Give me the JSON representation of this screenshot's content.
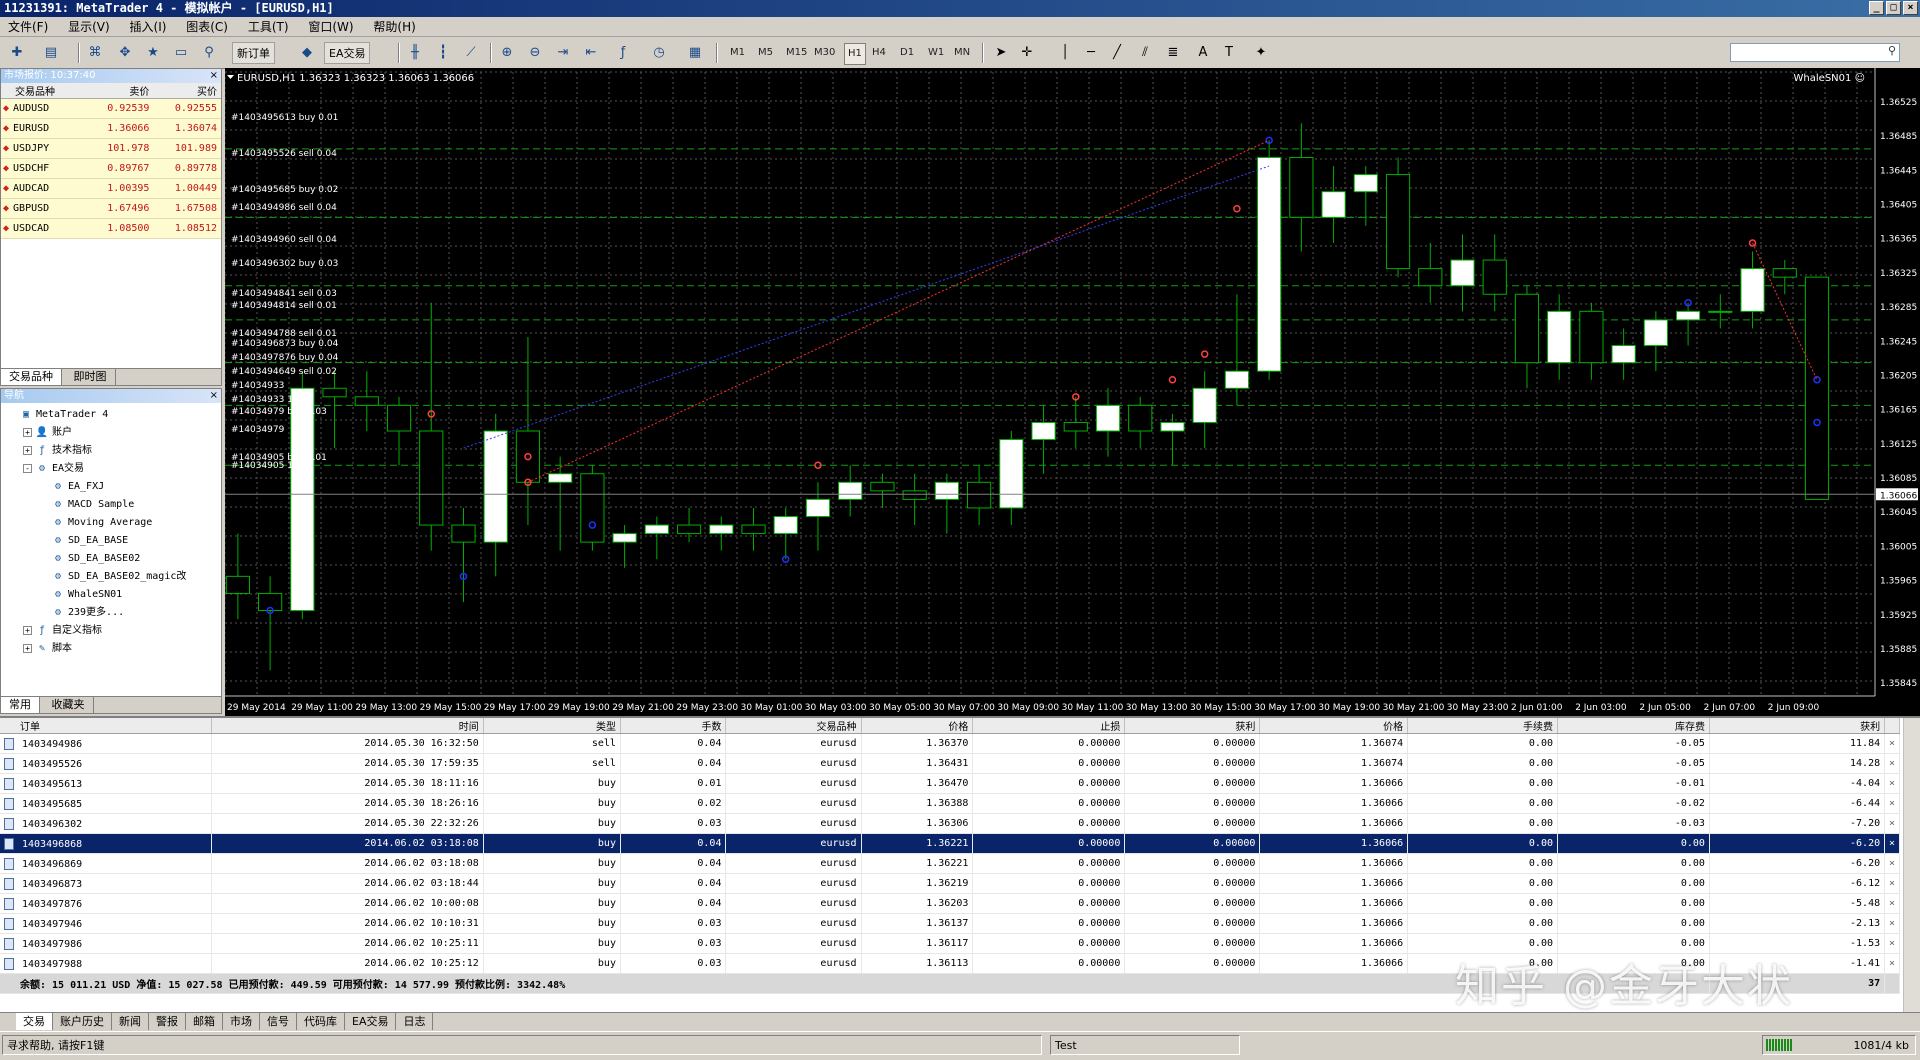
{
  "window": {
    "title": "11231391: MetaTrader 4 - 模拟帐户 - [EURUSD,H1]",
    "ctl_min": "_",
    "ctl_max": "□",
    "ctl_close": "×"
  },
  "menu": [
    "文件(F)",
    "显示(V)",
    "插入(I)",
    "图表(C)",
    "工具(T)",
    "窗口(W)",
    "帮助(H)"
  ],
  "toolbar": {
    "new_order": "新订单",
    "ea_trading": "EA交易",
    "timeframes": [
      "M1",
      "M5",
      "M15",
      "M30",
      "H1",
      "H4",
      "D1",
      "W1",
      "MN"
    ],
    "active_timeframe": "H1"
  },
  "market_watch": {
    "title": "市场报价: 10:37:40",
    "headers": [
      "交易品种",
      "卖价",
      "买价"
    ],
    "rows": [
      {
        "symbol": "AUDUSD",
        "bid": "0.92539",
        "ask": "0.92555"
      },
      {
        "symbol": "EURUSD",
        "bid": "1.36066",
        "ask": "1.36074"
      },
      {
        "symbol": "USDJPY",
        "bid": "101.978",
        "ask": "101.989"
      },
      {
        "symbol": "USDCHF",
        "bid": "0.89767",
        "ask": "0.89778"
      },
      {
        "symbol": "AUDCAD",
        "bid": "1.00395",
        "ask": "1.00449"
      },
      {
        "symbol": "GBPUSD",
        "bid": "1.67496",
        "ask": "1.67508"
      },
      {
        "symbol": "USDCAD",
        "bid": "1.08500",
        "ask": "1.08512"
      }
    ],
    "tabs": [
      "交易品种",
      "即时图"
    ]
  },
  "navigator": {
    "title": "导航",
    "items": [
      {
        "label": "MetaTrader 4",
        "level": 0,
        "expand": ""
      },
      {
        "label": "账户",
        "level": 1,
        "expand": "+"
      },
      {
        "label": "技术指标",
        "level": 1,
        "expand": "+"
      },
      {
        "label": "EA交易",
        "level": 1,
        "expand": "-"
      },
      {
        "label": "EA_FXJ",
        "level": 2,
        "expand": ""
      },
      {
        "label": "MACD Sample",
        "level": 2,
        "expand": ""
      },
      {
        "label": "Moving Average",
        "level": 2,
        "expand": ""
      },
      {
        "label": "SD_EA_BASE",
        "level": 2,
        "expand": ""
      },
      {
        "label": "SD_EA_BASE02",
        "level": 2,
        "expand": ""
      },
      {
        "label": "SD_EA_BASE02_magic改",
        "level": 2,
        "expand": ""
      },
      {
        "label": "WhaleSN01",
        "level": 2,
        "expand": ""
      },
      {
        "label": "239更多...",
        "level": 2,
        "expand": ""
      },
      {
        "label": "自定义指标",
        "level": 1,
        "expand": "+"
      },
      {
        "label": "脚本",
        "level": 1,
        "expand": "+"
      }
    ],
    "tabs": [
      "常用",
      "收藏夹"
    ]
  },
  "chart": {
    "header": "EURUSD,H1  1.36323 1.36323 1.36063 1.36066",
    "ea_label": "WhaleSN01 ☺",
    "current_price": "1.36066",
    "order_labels": [
      "#1403495613 buy 0.01",
      "#1403495526 sell 0.04",
      "#1403495685 buy 0.02",
      "#1403494986 sell 0.04",
      "#1403494960 sell 0.04",
      "#1403496302 buy 0.03",
      "#1403494841 sell 0.03",
      "#1403494814 sell 0.01",
      "#1403494788 sell 0.01",
      "#1403496873 buy 0.04",
      "#1403497876 buy 0.04",
      "#1403494649 sell 0.02",
      "#14034933",
      "#14034933 1.02",
      "#14034979 buy 0.03",
      "#14034979",
      "#14034905 buy 0.01",
      "#14034905 1.01"
    ],
    "time_labels": [
      "29 May 2014",
      "29 May 11:00",
      "29 May 13:00",
      "29 May 15:00",
      "29 May 17:00",
      "29 May 19:00",
      "29 May 21:00",
      "29 May 23:00",
      "30 May 01:00",
      "30 May 03:00",
      "30 May 05:00",
      "30 May 07:00",
      "30 May 09:00",
      "30 May 11:00",
      "30 May 13:00",
      "30 May 15:00",
      "30 May 17:00",
      "30 May 19:00",
      "30 May 21:00",
      "30 May 23:00",
      "2 Jun 01:00",
      "2 Jun 03:00",
      "2 Jun 05:00",
      "2 Jun 07:00",
      "2 Jun 09:00"
    ],
    "price_labels": [
      "1.36525",
      "1.36485",
      "1.36445",
      "1.36405",
      "1.36365",
      "1.36325",
      "1.36285",
      "1.36245",
      "1.36205",
      "1.36165",
      "1.36125",
      "1.36085",
      "1.36045",
      "1.36005",
      "1.35965",
      "1.35925",
      "1.35885",
      "1.35845"
    ]
  },
  "chart_data": {
    "type": "candlestick",
    "symbol": "EURUSD",
    "timeframe": "H1",
    "ylim": [
      1.3583,
      1.3656
    ],
    "candles": [
      [
        1.3597,
        1.3602,
        1.3592,
        1.3595
      ],
      [
        1.3595,
        1.3597,
        1.3586,
        1.3593
      ],
      [
        1.3593,
        1.3621,
        1.3592,
        1.3619
      ],
      [
        1.3619,
        1.3621,
        1.3612,
        1.3618
      ],
      [
        1.3618,
        1.3621,
        1.3614,
        1.3617
      ],
      [
        1.3617,
        1.3618,
        1.361,
        1.3614
      ],
      [
        1.3614,
        1.3629,
        1.36,
        1.3603
      ],
      [
        1.3603,
        1.3605,
        1.3594,
        1.3601
      ],
      [
        1.3601,
        1.3616,
        1.3597,
        1.3614
      ],
      [
        1.3614,
        1.3625,
        1.3603,
        1.3608
      ],
      [
        1.3608,
        1.3611,
        1.36,
        1.3609
      ],
      [
        1.3609,
        1.361,
        1.36,
        1.3601
      ],
      [
        1.3601,
        1.3603,
        1.3598,
        1.3602
      ],
      [
        1.3602,
        1.3604,
        1.3599,
        1.3603
      ],
      [
        1.3603,
        1.3605,
        1.3601,
        1.3602
      ],
      [
        1.3602,
        1.3604,
        1.36,
        1.3603
      ],
      [
        1.3603,
        1.3605,
        1.36,
        1.3602
      ],
      [
        1.3602,
        1.3605,
        1.3599,
        1.3604
      ],
      [
        1.3604,
        1.3608,
        1.36,
        1.3606
      ],
      [
        1.3606,
        1.361,
        1.3604,
        1.3608
      ],
      [
        1.3608,
        1.3609,
        1.3605,
        1.3607
      ],
      [
        1.3607,
        1.3609,
        1.3603,
        1.3606
      ],
      [
        1.3606,
        1.3609,
        1.3602,
        1.3608
      ],
      [
        1.3608,
        1.361,
        1.3603,
        1.3605
      ],
      [
        1.3605,
        1.3614,
        1.3603,
        1.3613
      ],
      [
        1.3613,
        1.3617,
        1.3609,
        1.3615
      ],
      [
        1.3615,
        1.3618,
        1.3612,
        1.3614
      ],
      [
        1.3614,
        1.3619,
        1.3611,
        1.3617
      ],
      [
        1.3617,
        1.3618,
        1.3612,
        1.3614
      ],
      [
        1.3614,
        1.3616,
        1.361,
        1.3615
      ],
      [
        1.3615,
        1.3621,
        1.3612,
        1.3619
      ],
      [
        1.3619,
        1.363,
        1.3617,
        1.3621
      ],
      [
        1.3621,
        1.3648,
        1.362,
        1.3646
      ],
      [
        1.3646,
        1.365,
        1.3635,
        1.3639
      ],
      [
        1.3639,
        1.3645,
        1.3636,
        1.3642
      ],
      [
        1.3642,
        1.3645,
        1.3638,
        1.3644
      ],
      [
        1.3644,
        1.3646,
        1.3632,
        1.3633
      ],
      [
        1.3633,
        1.3636,
        1.3629,
        1.3631
      ],
      [
        1.3631,
        1.3637,
        1.3628,
        1.3634
      ],
      [
        1.3634,
        1.3637,
        1.3628,
        1.363
      ],
      [
        1.363,
        1.3631,
        1.3619,
        1.3622
      ],
      [
        1.3622,
        1.363,
        1.362,
        1.3628
      ],
      [
        1.3628,
        1.3629,
        1.362,
        1.3622
      ],
      [
        1.3622,
        1.3626,
        1.362,
        1.3624
      ],
      [
        1.3624,
        1.3628,
        1.3621,
        1.3627
      ],
      [
        1.3627,
        1.3629,
        1.3624,
        1.3628
      ],
      [
        1.3628,
        1.363,
        1.3626,
        1.3628
      ],
      [
        1.3628,
        1.3635,
        1.3626,
        1.3633
      ],
      [
        1.3633,
        1.3634,
        1.363,
        1.3632
      ],
      [
        1.3632,
        1.3632,
        1.3606,
        1.3606
      ]
    ]
  },
  "terminal": {
    "headers": [
      "订单",
      "时间",
      "类型",
      "手数",
      "交易品种",
      "价格",
      "止损",
      "获利",
      "价格",
      "手续费",
      "库存费",
      "获利",
      ""
    ],
    "rows": [
      [
        "1403494986",
        "2014.05.30 16:32:50",
        "sell",
        "0.04",
        "eurusd",
        "1.36370",
        "0.00000",
        "0.00000",
        "1.36074",
        "0.00",
        "-0.05",
        "11.84",
        "×"
      ],
      [
        "1403495526",
        "2014.05.30 17:59:35",
        "sell",
        "0.04",
        "eurusd",
        "1.36431",
        "0.00000",
        "0.00000",
        "1.36074",
        "0.00",
        "-0.05",
        "14.28",
        "×"
      ],
      [
        "1403495613",
        "2014.05.30 18:11:16",
        "buy",
        "0.01",
        "eurusd",
        "1.36470",
        "0.00000",
        "0.00000",
        "1.36066",
        "0.00",
        "-0.01",
        "-4.04",
        "×"
      ],
      [
        "1403495685",
        "2014.05.30 18:26:16",
        "buy",
        "0.02",
        "eurusd",
        "1.36388",
        "0.00000",
        "0.00000",
        "1.36066",
        "0.00",
        "-0.02",
        "-6.44",
        "×"
      ],
      [
        "1403496302",
        "2014.05.30 22:32:26",
        "buy",
        "0.03",
        "eurusd",
        "1.36306",
        "0.00000",
        "0.00000",
        "1.36066",
        "0.00",
        "-0.03",
        "-7.20",
        "×"
      ],
      [
        "1403496868",
        "2014.06.02 03:18:08",
        "buy",
        "0.04",
        "eurusd",
        "1.36221",
        "0.00000",
        "0.00000",
        "1.36066",
        "0.00",
        "0.00",
        "-6.20",
        "×"
      ],
      [
        "1403496869",
        "2014.06.02 03:18:08",
        "buy",
        "0.04",
        "eurusd",
        "1.36221",
        "0.00000",
        "0.00000",
        "1.36066",
        "0.00",
        "0.00",
        "-6.20",
        "×"
      ],
      [
        "1403496873",
        "2014.06.02 03:18:44",
        "buy",
        "0.04",
        "eurusd",
        "1.36219",
        "0.00000",
        "0.00000",
        "1.36066",
        "0.00",
        "0.00",
        "-6.12",
        "×"
      ],
      [
        "1403497876",
        "2014.06.02 10:00:08",
        "buy",
        "0.04",
        "eurusd",
        "1.36203",
        "0.00000",
        "0.00000",
        "1.36066",
        "0.00",
        "0.00",
        "-5.48",
        "×"
      ],
      [
        "1403497946",
        "2014.06.02 10:10:31",
        "buy",
        "0.03",
        "eurusd",
        "1.36137",
        "0.00000",
        "0.00000",
        "1.36066",
        "0.00",
        "0.00",
        "-2.13",
        "×"
      ],
      [
        "1403497986",
        "2014.06.02 10:25:11",
        "buy",
        "0.03",
        "eurusd",
        "1.36117",
        "0.00000",
        "0.00000",
        "1.36066",
        "0.00",
        "0.00",
        "-1.53",
        "×"
      ],
      [
        "1403497988",
        "2014.06.02 10:25:12",
        "buy",
        "0.03",
        "eurusd",
        "1.36113",
        "0.00000",
        "0.00000",
        "1.36066",
        "0.00",
        "0.00",
        "-1.41",
        "×"
      ]
    ],
    "selected_row": 5,
    "balance_line": "余额: 15 011.21 USD  净值: 15 027.58  已用预付款: 449.59  可用预付款: 14 577.99  预付款比例: 3342.48%",
    "balance_total": "37"
  },
  "terminal_tabs": [
    "交易",
    "账户历史",
    "新闻",
    "警报",
    "邮箱",
    "市场",
    "信号",
    "代码库",
    "EA交易",
    "日志"
  ],
  "status": {
    "help": "寻求帮助, 请按F1键",
    "profile": "Test",
    "traffic": "1081/4 kb"
  },
  "watermark": "知乎 @金牙大状",
  "colors": {
    "bull": "#ffffff",
    "bear": "#000000",
    "wick": "#00b000",
    "grid": "#555555",
    "buy_marker": "#2030ff",
    "sell_marker": "#ff4040"
  }
}
